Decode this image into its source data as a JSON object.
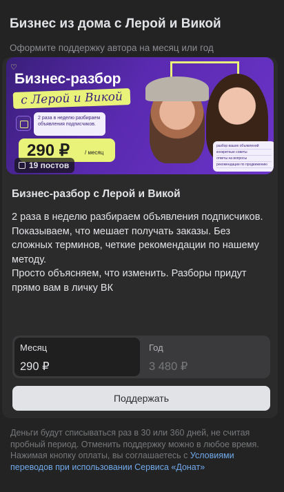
{
  "header": {
    "title": "Бизнес из дома с Лерой и Викой",
    "subtitle": "Оформите поддержку автора на месяц или год"
  },
  "banner": {
    "title": "Бизнес-разбор",
    "ribbon": "с Лерой и Викой",
    "schedule": "2 раза в неделю разбираем объявления подписчиков.",
    "price": "290 ₽",
    "price_per": "/ месяц",
    "posts_badge": "19 постов",
    "checklist": [
      "разбор ваших объявлений",
      "конкретные советы",
      "ответы на вопросы",
      "рекомендации по продвижению"
    ]
  },
  "tier": {
    "title": "Бизнес-разбор с Лерой и Викой",
    "description": "2 раза в неделю разбираем объявления подписчиков. Показываем, что мешает получать заказы. Без сложных терминов, четкие рекомендации по нашему методу.\nПросто объясняем, что изменить. Разборы придут прямо вам в личку ВК"
  },
  "periods": [
    {
      "name": "Месяц",
      "price": "290 ₽",
      "selected": true
    },
    {
      "name": "Год",
      "price": "3 480 ₽",
      "selected": false
    }
  ],
  "support_button": "Поддержать",
  "footer": {
    "text": "Деньги будут списываться раз в 30 или 360 дней, не считая пробный период. Отменить поддержку можно в любое время. Нажимая кнопку оплаты, вы соглашаетесь с ",
    "link": "Условиями переводов при использовании Сервиса «Донат»"
  },
  "colors": {
    "accent_yellow": "#e9f37a",
    "banner_purple": "#5a2ab0",
    "link": "#71aaeb"
  }
}
